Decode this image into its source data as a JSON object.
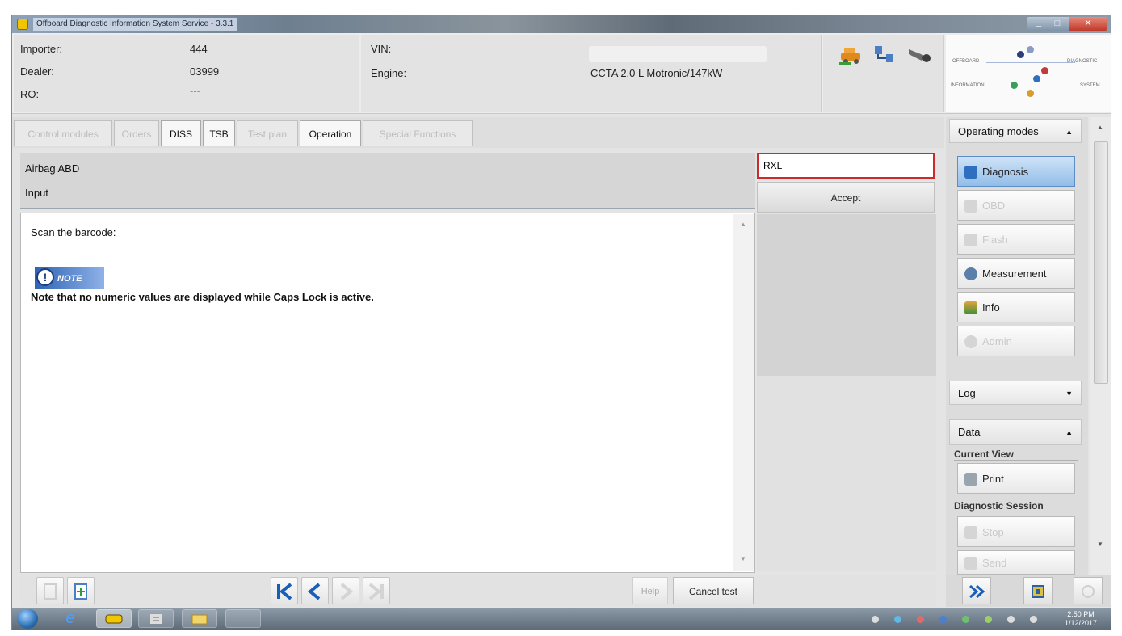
{
  "window": {
    "title": "Offboard Diagnostic Information System Service - 3.3.1",
    "min": "_",
    "max": "□",
    "close": "✕"
  },
  "header": {
    "importer_label": "Importer:",
    "importer_value": "444",
    "dealer_label": "Dealer:",
    "dealer_value": "03999",
    "ro_label": "RO:",
    "ro_value": "---",
    "vin_label": "VIN:",
    "engine_label": "Engine:",
    "engine_value": "CCTA 2.0 L Motronic/147kW",
    "brand_words": [
      "OFFBOARD",
      "DIAGNOSTIC",
      "INFORMATION",
      "SYSTEM"
    ]
  },
  "tabs": [
    {
      "label": "Control modules",
      "active": false
    },
    {
      "label": "Orders",
      "active": false
    },
    {
      "label": "DISS",
      "active": true
    },
    {
      "label": "TSB",
      "active": true
    },
    {
      "label": "Test plan",
      "active": false
    },
    {
      "label": "Operation",
      "active": true
    },
    {
      "label": "Special Functions",
      "active": false
    }
  ],
  "main": {
    "module": "Airbag ABD",
    "section": "Input",
    "input_value": "RXL",
    "accept_label": "Accept",
    "instruction": "Scan the barcode:",
    "note_badge": "NOTE",
    "note_icon": "!",
    "note_text": "Note that no numeric values are displayed while Caps Lock is active.",
    "scroll_up": "▲",
    "scroll_down": "▼"
  },
  "toolbar": {
    "first": "⏮",
    "prev": "<",
    "next": ">",
    "last": ">|",
    "help_label": "Help",
    "cancel_label": "Cancel test"
  },
  "sidebar": {
    "operating_modes_label": "Operating modes",
    "operating_modes_chevron": "▲",
    "modes": [
      {
        "label": "Diagnosis",
        "active": true,
        "enabled": true,
        "color": "#2e6fc0"
      },
      {
        "label": "OBD",
        "active": false,
        "enabled": false,
        "color": "#c9c9c9"
      },
      {
        "label": "Flash",
        "active": false,
        "enabled": false,
        "color": "#c9c9c9"
      },
      {
        "label": "Measurement",
        "active": false,
        "enabled": true,
        "color": "#5a7fa8"
      },
      {
        "label": "Info",
        "active": false,
        "enabled": true,
        "color": "#3d8f3a"
      },
      {
        "label": "Admin",
        "active": false,
        "enabled": false,
        "color": "#c9c9c9"
      }
    ],
    "log_label": "Log",
    "log_chevron": "▼",
    "data_label": "Data",
    "data_chevron": "▲",
    "current_view_label": "Current View",
    "print_label": "Print",
    "diag_session_label": "Diagnostic Session",
    "stop_label": "Stop",
    "send_label": "Send",
    "scroll_up": "▲",
    "scroll_down": "▼"
  },
  "taskbar": {
    "time": "2:50 PM",
    "date": "1/12/2017"
  },
  "colors": {
    "accent_blue": "#1b5fb5",
    "input_border_red": "#cc2b2b",
    "active_mode_bg": "#92bde8"
  }
}
